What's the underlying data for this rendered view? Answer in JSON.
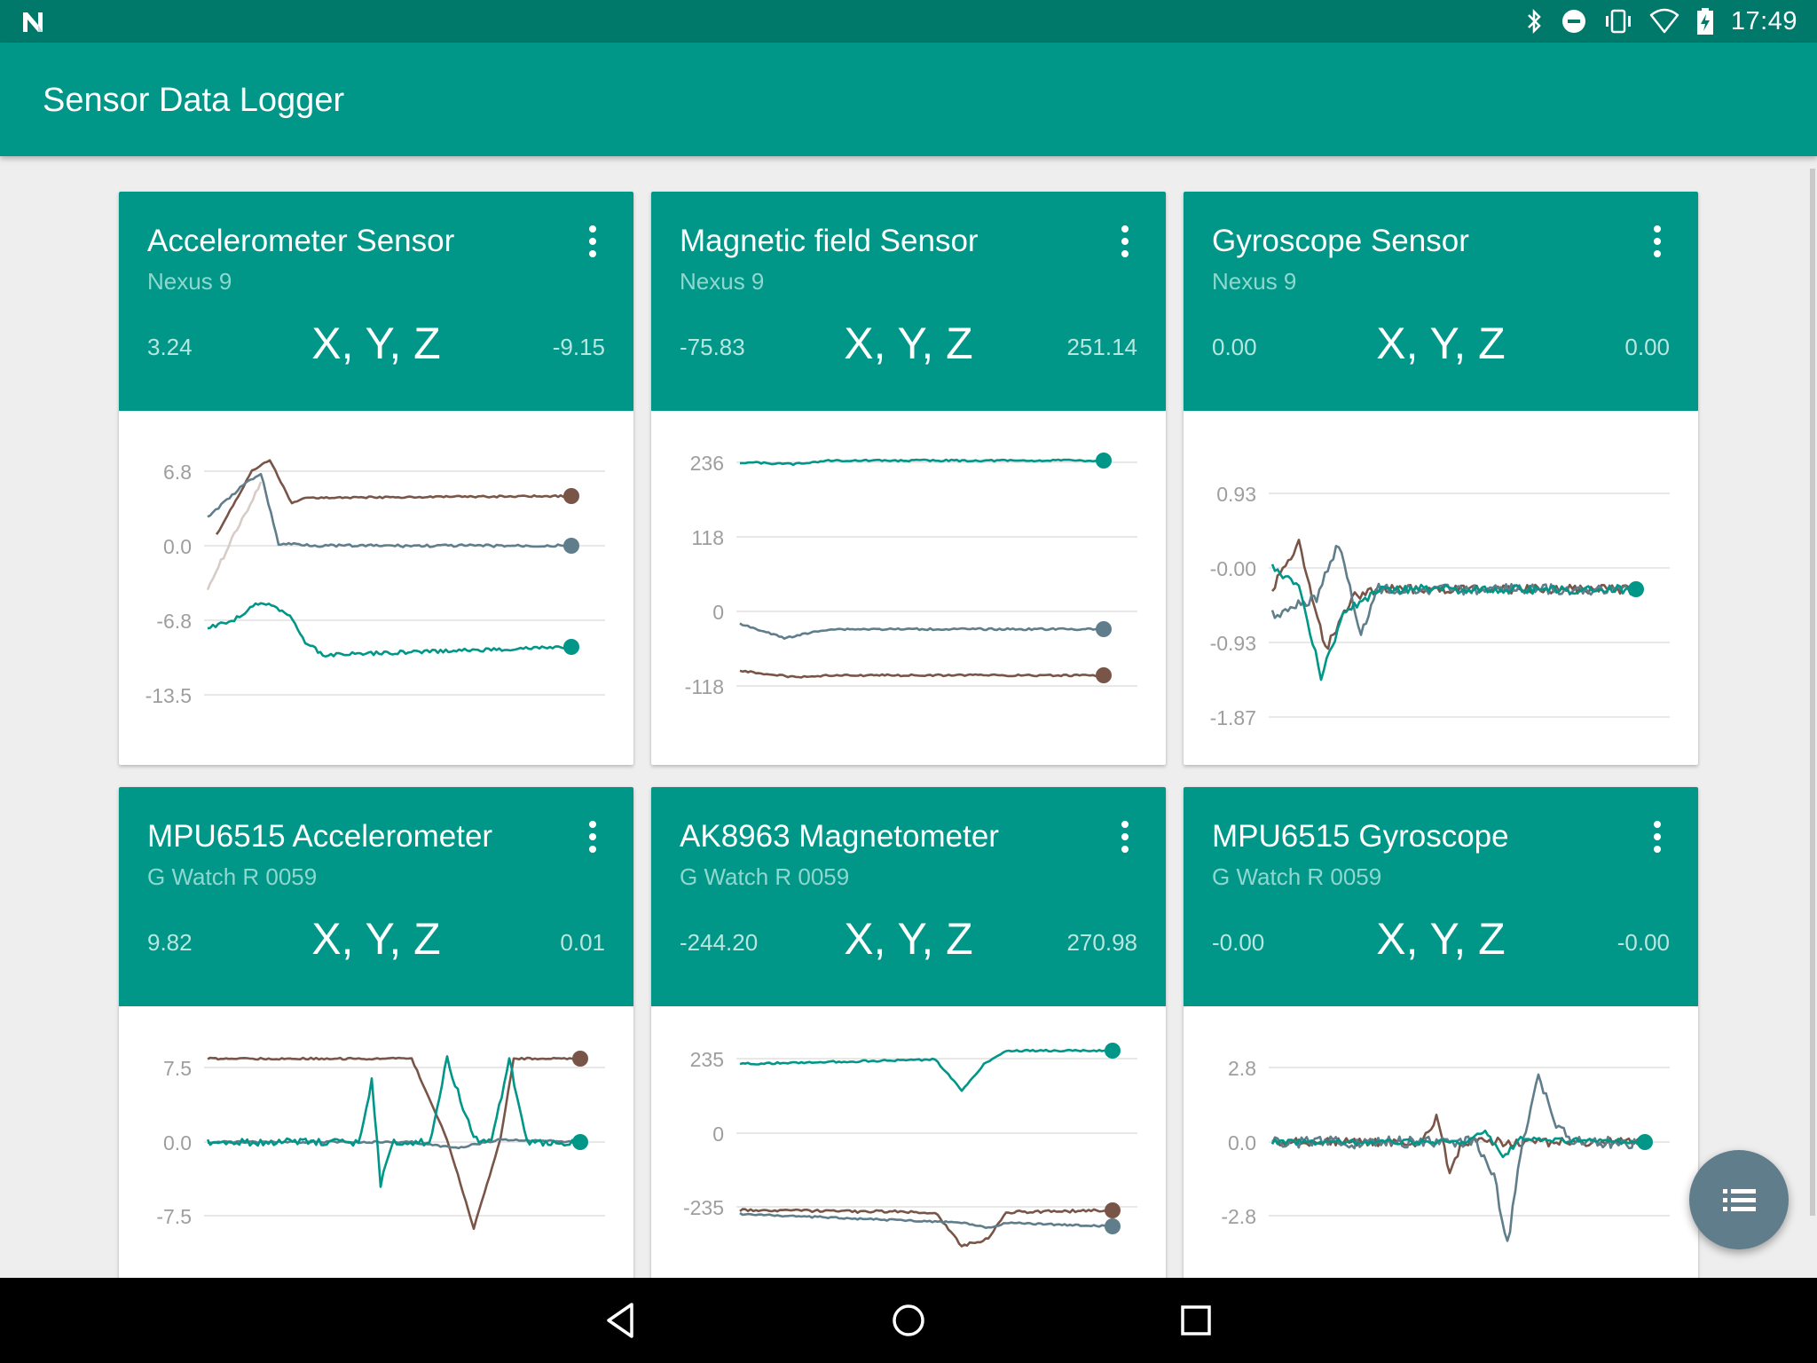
{
  "status_bar": {
    "time": "17:49"
  },
  "app": {
    "title": "Sensor Data Logger"
  },
  "colors": {
    "primary": "#009688",
    "primary_dark": "#00796b",
    "x_series": "#795548",
    "y_series": "#607d8b",
    "z_series": "#009688"
  },
  "cards": [
    {
      "title": "Accelerometer Sensor",
      "device": "Nexus 9",
      "value_left": "3.24",
      "axes_label": "X, Y, Z",
      "value_right": "-9.15",
      "ticks": [
        "6.8",
        "0.0",
        "-6.8",
        "-13.5"
      ]
    },
    {
      "title": "Magnetic field Sensor",
      "device": "Nexus 9",
      "value_left": "-75.83",
      "axes_label": "X, Y, Z",
      "value_right": "251.14",
      "ticks": [
        "236",
        "118",
        "0",
        "-118"
      ]
    },
    {
      "title": "Gyroscope Sensor",
      "device": "Nexus 9",
      "value_left": "0.00",
      "axes_label": "X, Y, Z",
      "value_right": "0.00",
      "ticks": [
        "0.93",
        "-0.00",
        "-0.93",
        "-1.87"
      ]
    },
    {
      "title": "MPU6515 Accelerometer",
      "device": "G Watch R 0059",
      "value_left": "9.82",
      "axes_label": "X, Y, Z",
      "value_right": "0.01",
      "ticks": [
        "7.5",
        "0.0",
        "-7.5"
      ]
    },
    {
      "title": "AK8963 Magnetometer",
      "device": "G Watch R 0059",
      "value_left": "-244.20",
      "axes_label": "X, Y, Z",
      "value_right": "270.98",
      "ticks": [
        "235",
        "0",
        "-235"
      ]
    },
    {
      "title": "MPU6515 Gyroscope",
      "device": "G Watch R 0059",
      "value_left": "-0.00",
      "axes_label": "X, Y, Z",
      "value_right": "-0.00",
      "ticks": [
        "2.8",
        "0.0",
        "-2.8"
      ]
    }
  ],
  "icons": {
    "status_logo": "n-logo-icon",
    "bluetooth": "bluetooth-icon",
    "dnd": "do-not-disturb-icon",
    "vibrate": "vibrate-icon",
    "wifi": "wifi-icon",
    "battery": "battery-charging-icon",
    "card_menu": "more-vert-icon",
    "fab": "list-icon",
    "back": "back-icon",
    "home": "home-icon",
    "recents": "recents-icon"
  }
}
